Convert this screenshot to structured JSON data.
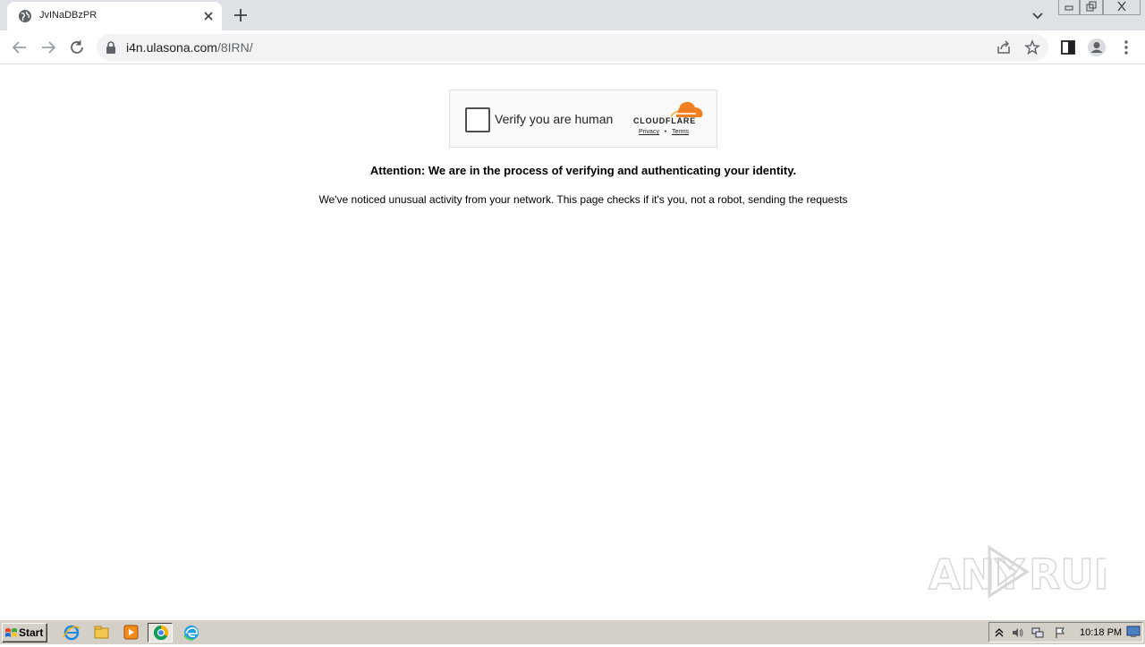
{
  "browser": {
    "tab": {
      "title": "JvINaDBzPR"
    },
    "address": {
      "host": "i4n.ulasona.com",
      "path": "/8IRN/"
    }
  },
  "captcha": {
    "checkbox_label": "Verify you are human",
    "brand": "CLOUDFLARE",
    "privacy_link": "Privacy",
    "separator": "•",
    "terms_link": "Terms",
    "brand_color": "#f38020"
  },
  "content": {
    "attention": "Attention: We are in the process of verifying and authenticating your identity.",
    "notice": "We've noticed unusual activity from your network. This page checks if it's you, not a robot, sending the requests"
  },
  "watermark": {
    "text": "ANY RUN"
  },
  "taskbar": {
    "start_label": "Start",
    "apps": [
      "ie-icon",
      "explorer-icon",
      "media-player-icon",
      "chrome-icon",
      "edge-icon"
    ],
    "clock": "10:18 PM"
  }
}
